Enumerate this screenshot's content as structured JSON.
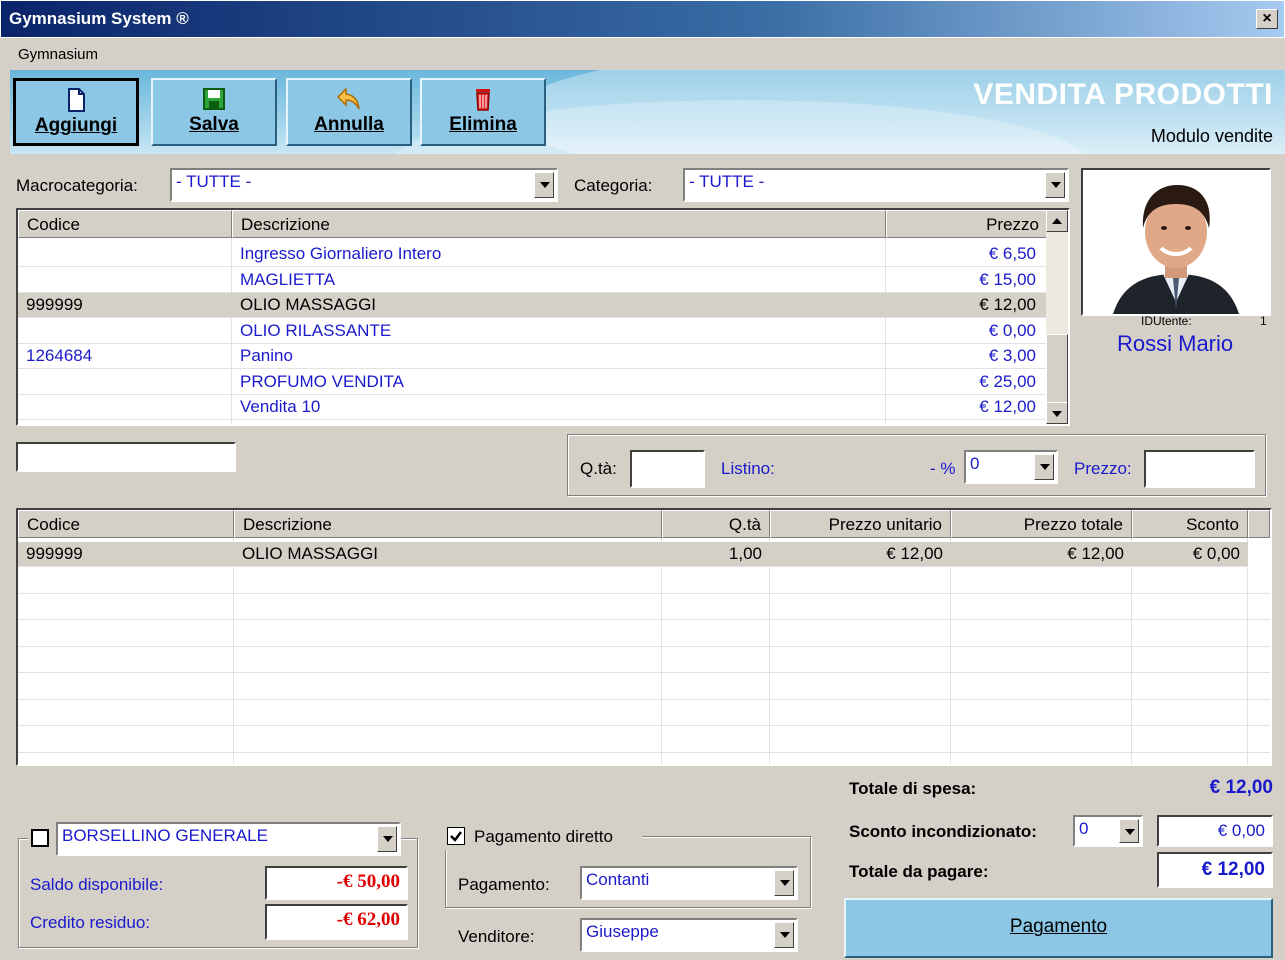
{
  "window": {
    "title": "Gymnasium System ®",
    "close_label": "×"
  },
  "menu": {
    "gymnasium": "Gymnasium"
  },
  "toolbar": {
    "add": "Aggiungi",
    "save": "Salva",
    "cancel": "Annulla",
    "delete": "Elimina"
  },
  "header": {
    "title": "VENDITA PRODOTTI",
    "subtitle": "Modulo vendite"
  },
  "filters": {
    "macro_label": "Macrocategoria:",
    "macro_value": "- TUTTE -",
    "cat_label": "Categoria:",
    "cat_value": "- TUTTE -"
  },
  "products": {
    "columns": [
      "Codice",
      "Descrizione",
      "Prezzo"
    ],
    "rows": [
      {
        "code": "",
        "desc": "Ingresso Giornaliero Intero",
        "price": "€ 6,50"
      },
      {
        "code": "",
        "desc": "MAGLIETTA",
        "price": "€ 15,00"
      },
      {
        "code": "999999",
        "desc": "OLIO MASSAGGI",
        "price": "€ 12,00"
      },
      {
        "code": "",
        "desc": "OLIO RILASSANTE",
        "price": "€ 0,00"
      },
      {
        "code": "1264684",
        "desc": "Panino",
        "price": "€ 3,00"
      },
      {
        "code": "",
        "desc": "PROFUMO VENDITA",
        "price": "€ 25,00"
      },
      {
        "code": "",
        "desc": "Vendita 10",
        "price": "€ 12,00"
      }
    ]
  },
  "user": {
    "id_label": "IDUtente:",
    "id_value": "1",
    "name": "Rossi Mario"
  },
  "entry": {
    "search_value": "",
    "qty_label": "Q.tà:",
    "qty_value": "",
    "listino_label": "Listino:",
    "discount_label": "- %",
    "discount_value": "0",
    "price_label": "Prezzo:",
    "price_value": ""
  },
  "cart": {
    "columns": [
      "Codice",
      "Descrizione",
      "Q.tà",
      "Prezzo unitario",
      "Prezzo totale",
      "Sconto"
    ],
    "rows": [
      {
        "code": "999999",
        "desc": "OLIO MASSAGGI",
        "qty": "1,00",
        "unit": "€ 12,00",
        "total": "€ 12,00",
        "disc": "€ 0,00"
      }
    ]
  },
  "wallet": {
    "label": "BORSELLINO GENERALE",
    "balance_label": "Saldo disponibile:",
    "balance_value": "-€ 50,00",
    "credit_label": "Credito residuo:",
    "credit_value": "-€ 62,00"
  },
  "payment": {
    "direct_label": "Pagamento diretto",
    "method_label": "Pagamento:",
    "method_value": "Contanti",
    "seller_label": "Venditore:",
    "seller_value": "Giuseppe"
  },
  "totals": {
    "spend_label": "Totale di spesa:",
    "spend_value": "€ 12,00",
    "discount_label": "Sconto incondizionato:",
    "discount_select": "0",
    "discount_value": "€ 0,00",
    "due_label": "Totale da pagare:",
    "due_value": "€ 12,00"
  },
  "pay_button": "Pagamento",
  "colors": {
    "accent_blue": "#1a1acc",
    "header_blue": "#6ab7dc",
    "negative_red": "#e00000"
  }
}
